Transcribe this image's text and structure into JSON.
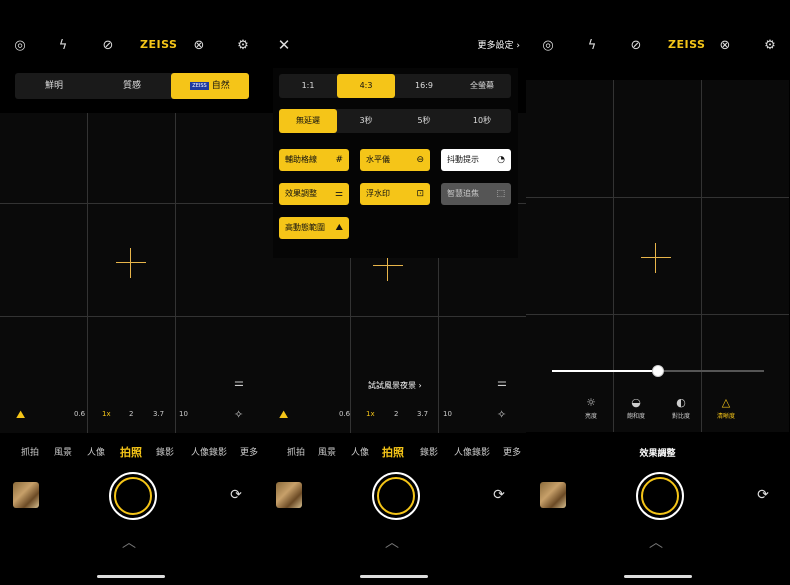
{
  "topbar": {
    "zeiss": "ZEISS",
    "more_settings": "更多設定"
  },
  "filters": [
    "鮮明",
    "質感",
    "自然"
  ],
  "filter_zeiss_badge": "ZEISS",
  "zoom": [
    "0.6",
    "1x",
    "2",
    "3.7",
    "10"
  ],
  "modes": [
    "抓拍",
    "風景",
    "人像",
    "拍照",
    "錄影",
    "人像錄影",
    "更多"
  ],
  "aspect": [
    "1:1",
    "4:3",
    "16:9",
    "全螢幕"
  ],
  "timer": [
    "無延遲",
    "3秒",
    "5秒",
    "10秒"
  ],
  "options": {
    "grid": "輔助格線",
    "level": "水平儀",
    "shake": "抖動提示",
    "effects": "效果調整",
    "watermark": "浮水印",
    "smart_focus": "智慧追焦",
    "hdr": "高動態範圍"
  },
  "scene_hint": "試試風景夜景",
  "adjust": {
    "title": "效果調整",
    "items": [
      "亮度",
      "飽和度",
      "對比度",
      "清晰度"
    ],
    "slider_value": 0.5
  },
  "colors": {
    "accent": "#f5c518"
  }
}
